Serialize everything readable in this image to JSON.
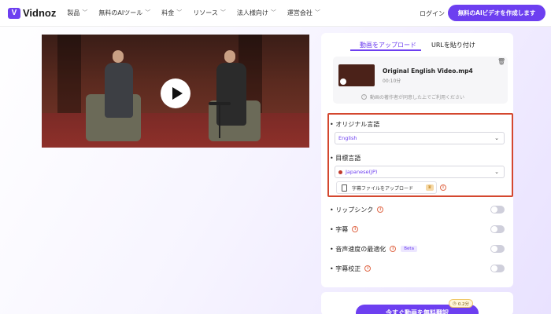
{
  "header": {
    "logo_text": "Vidnoz",
    "nav": [
      "製品",
      "無料のAIツール",
      "料金",
      "リソース",
      "法人様向け",
      "運営会社"
    ],
    "login": "ログイン",
    "cta": "無料のAIビデオを作成します"
  },
  "video": {
    "play_label": "play"
  },
  "tabs": {
    "upload": "動画をアップロード",
    "url": "URLを貼り付け"
  },
  "file": {
    "name": "Original English Video.mp4",
    "duration": "00:10分",
    "consent": "動画の著作者が同意した上でご利用ください"
  },
  "languages": {
    "original_label": "• オリジナル言語",
    "original_value": "English",
    "target_label": "• 目標言語",
    "target_value": "Japanese(JP)",
    "subtitle_upload": "字幕ファイルをアップロード"
  },
  "options": [
    {
      "label": "• リップシンク",
      "on": false
    },
    {
      "label": "• 字幕",
      "on": false
    },
    {
      "label": "• 音声速度の最適化",
      "on": false,
      "badge": "Beta"
    },
    {
      "label": "• 字幕校正",
      "on": false
    }
  ],
  "translate": {
    "button": "今すぐ動画を無料翻訳",
    "time_badge": "0.2分"
  },
  "colors": {
    "accent": "#6d3ff0",
    "highlight": "#d4472f"
  }
}
